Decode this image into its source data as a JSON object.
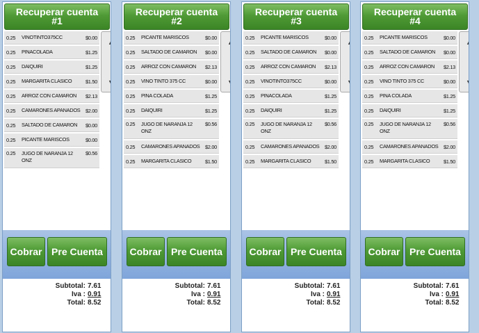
{
  "accounts": [
    {
      "header_line1": "Recuperar cuenta",
      "header_line2": "#1",
      "items": [
        {
          "qty": "0.25",
          "name": "VINOTINTO375CC",
          "price": "$0.00"
        },
        {
          "qty": "0.25",
          "name": "PINACOLADA",
          "price": "$1.25"
        },
        {
          "qty": "0.25",
          "name": "DAIQUIRI",
          "price": "$1.25"
        },
        {
          "qty": "0.25",
          "name": "MARGARITA CLASICO",
          "price": "$1.50"
        },
        {
          "qty": "0.25",
          "name": "ARROZ CON CAMARON",
          "price": "$2.13"
        },
        {
          "qty": "0.25",
          "name": "CAMARONES APANADOS",
          "price": "$2.00"
        },
        {
          "qty": "0.25",
          "name": "SALTADO DE CAMARON",
          "price": "$0.00"
        },
        {
          "qty": "0.25",
          "name": "PICANTE MARISCOS",
          "price": "$0.00"
        },
        {
          "qty": "0.25",
          "name": "JUGO DE NARANJA 12 ONZ",
          "price": "$0.56"
        }
      ],
      "cobrar_label": "Cobrar",
      "precuenta_label": "Pre Cuenta",
      "subtotal_label": "Subtotal:",
      "subtotal_value": "7.61",
      "iva_label": "Iva :",
      "iva_value": "0.91",
      "total_label": "Total:",
      "total_value": "8.52"
    },
    {
      "header_line1": "Recuperar cuenta",
      "header_line2": "#2",
      "items": [
        {
          "qty": "0.25",
          "name": "PICANTE MARISCOS",
          "price": "$0.00"
        },
        {
          "qty": "0.25",
          "name": "SALTADO DE CAMARON",
          "price": "$0.00"
        },
        {
          "qty": "0.25",
          "name": "ARROZ CON CAMARON",
          "price": "$2.13"
        },
        {
          "qty": "0.25",
          "name": "VINO TINTO 375 CC",
          "price": "$0.00"
        },
        {
          "qty": "0.25",
          "name": "PINA COLADA",
          "price": "$1.25"
        },
        {
          "qty": "0.25",
          "name": "DAIQUIRI",
          "price": "$1.25"
        },
        {
          "qty": "0.25",
          "name": "JUGO DE NARANJA 12 ONZ",
          "price": "$0.56"
        },
        {
          "qty": "0.25",
          "name": "CAMARONES APANADOS",
          "price": "$2.00"
        },
        {
          "qty": "0.25",
          "name": "MARGARITA CLASICO",
          "price": "$1.50"
        }
      ],
      "cobrar_label": "Cobrar",
      "precuenta_label": "Pre Cuenta",
      "subtotal_label": "Subtotal:",
      "subtotal_value": "7.61",
      "iva_label": "Iva :",
      "iva_value": "0.91",
      "total_label": "Total:",
      "total_value": "8.52"
    },
    {
      "header_line1": "Recuperar cuenta",
      "header_line2": "#3",
      "items": [
        {
          "qty": "0.25",
          "name": "PICANTE MARISCOS",
          "price": "$0.00"
        },
        {
          "qty": "0.25",
          "name": "SALTADO DE CAMARON",
          "price": "$0.00"
        },
        {
          "qty": "0.25",
          "name": "ARROZ CON CAMARON",
          "price": "$2.13"
        },
        {
          "qty": "0.25",
          "name": "VINOTINTO375CC",
          "price": "$0.00"
        },
        {
          "qty": "0.25",
          "name": "PINACOLADA",
          "price": "$1.25"
        },
        {
          "qty": "0.25",
          "name": "DAIQUIRI",
          "price": "$1.25"
        },
        {
          "qty": "0.25",
          "name": "JUGO DE NARANJA 12 ONZ",
          "price": "$0.56"
        },
        {
          "qty": "0.25",
          "name": "CAMARONES APANADOS",
          "price": "$2.00"
        },
        {
          "qty": "0.25",
          "name": "MARGARITA CLASICO",
          "price": "$1.50"
        }
      ],
      "cobrar_label": "Cobrar",
      "precuenta_label": "Pre Cuenta",
      "subtotal_label": "Subtotal:",
      "subtotal_value": "7.61",
      "iva_label": "Iva :",
      "iva_value": "0.91",
      "total_label": "Total:",
      "total_value": "8.52"
    },
    {
      "header_line1": "Recuperar cuenta",
      "header_line2": "#4",
      "items": [
        {
          "qty": "0.25",
          "name": "PICANTE MARISCOS",
          "price": "$0.00"
        },
        {
          "qty": "0.25",
          "name": "SALTADO DE CAMARON",
          "price": "$0.00"
        },
        {
          "qty": "0.25",
          "name": "ARROZ CON CAMARON",
          "price": "$2.13"
        },
        {
          "qty": "0.25",
          "name": "VINO TINTO 375 CC",
          "price": "$0.00"
        },
        {
          "qty": "0.25",
          "name": "PINA COLADA",
          "price": "$1.25"
        },
        {
          "qty": "0.25",
          "name": "DAIQUIRI",
          "price": "$1.25"
        },
        {
          "qty": "0.25",
          "name": "JUGO DE NARANJA 12 ONZ",
          "price": "$0.56"
        },
        {
          "qty": "0.25",
          "name": "CAMARONES APANADOS",
          "price": "$2.00"
        },
        {
          "qty": "0.25",
          "name": "MARGARITA CLASICO",
          "price": "$1.50"
        }
      ],
      "cobrar_label": "Cobrar",
      "precuenta_label": "Pre Cuenta",
      "subtotal_label": "Subtotal:",
      "subtotal_value": "7.61",
      "iva_label": "Iva :",
      "iva_value": "0.91",
      "total_label": "Total:",
      "total_value": "8.52"
    }
  ],
  "scroll_up_glyph": "▲",
  "scroll_down_glyph": "▼"
}
